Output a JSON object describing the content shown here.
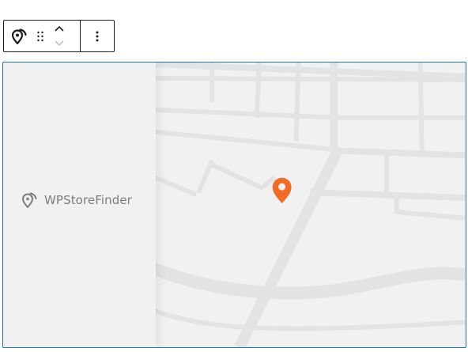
{
  "toolbar": {
    "block_icon": "store-locator-pin-icon",
    "drag_icon": "drag-handle-icon",
    "move_up_icon": "chevron-up-icon",
    "move_down_icon": "chevron-down-icon",
    "more_icon": "more-vertical-icon"
  },
  "block": {
    "brand_name": "WPStoreFinder",
    "brand_icon": "store-locator-pin-icon",
    "marker_icon": "map-marker-icon",
    "marker_color": "#f26b24",
    "border_color": "#1f6ea8",
    "road_color": "#e3e3e3",
    "background_color": "#f1f1f1"
  }
}
